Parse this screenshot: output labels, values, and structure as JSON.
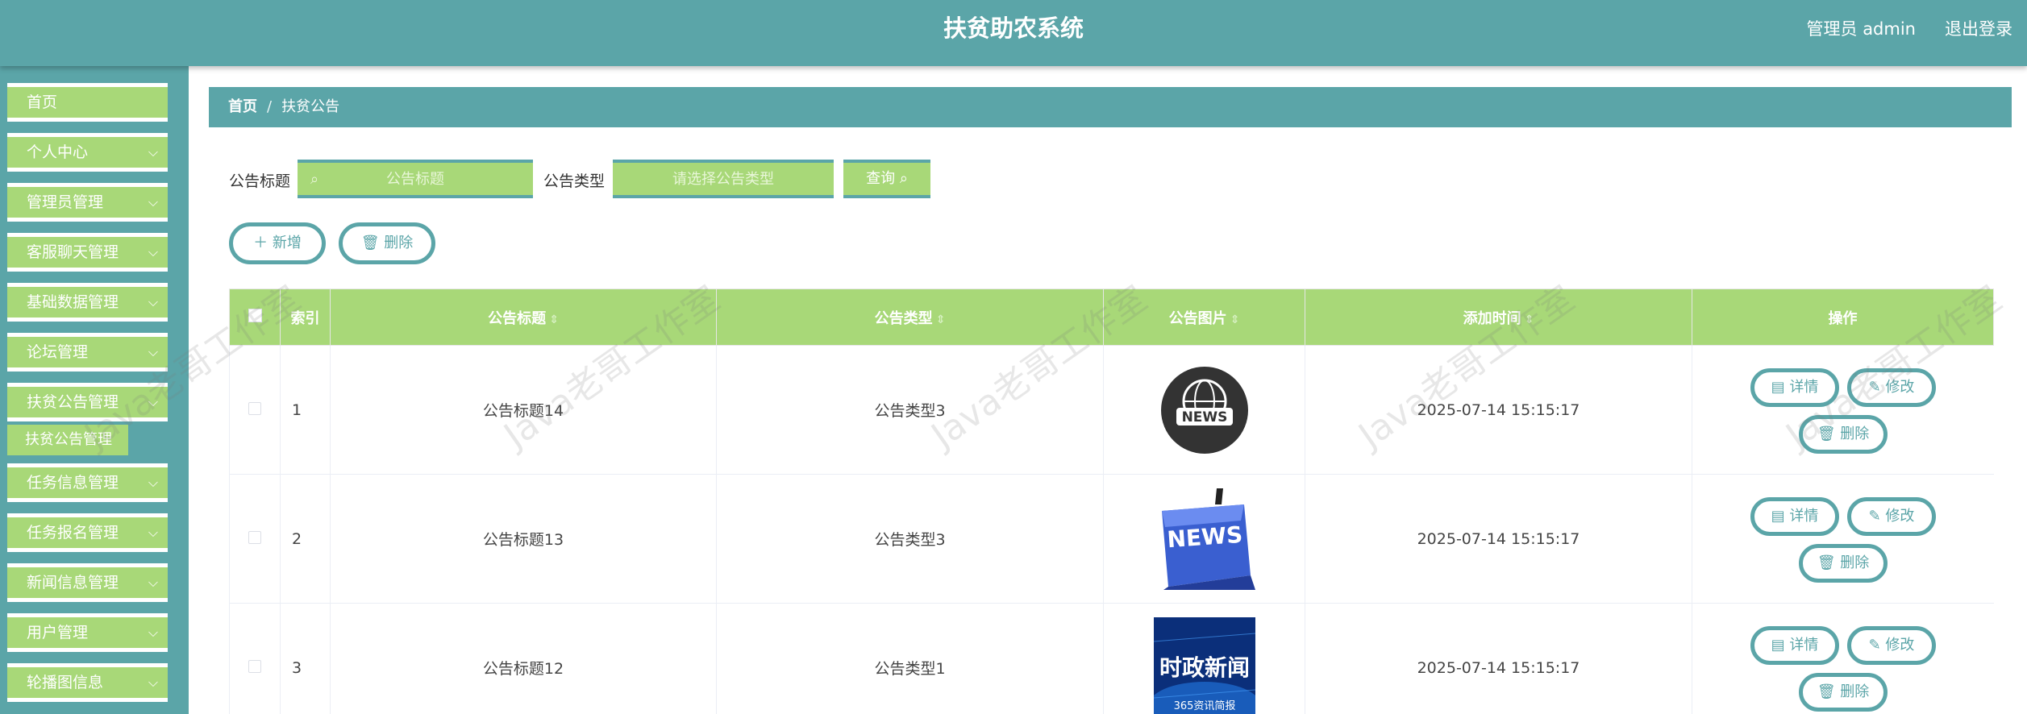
{
  "header": {
    "title": "扶贫助农系统",
    "user": "管理员 admin",
    "logout": "退出登录"
  },
  "sidebar": {
    "items": [
      {
        "label": "首页",
        "has_arrow": false
      },
      {
        "label": "个人中心",
        "has_arrow": true
      },
      {
        "label": "管理员管理",
        "has_arrow": true
      },
      {
        "label": "客服聊天管理",
        "has_arrow": true
      },
      {
        "label": "基础数据管理",
        "has_arrow": true
      },
      {
        "label": "论坛管理",
        "has_arrow": true
      },
      {
        "label": "扶贫公告管理",
        "has_arrow": true
      },
      {
        "label": "任务信息管理",
        "has_arrow": true
      },
      {
        "label": "任务报名管理",
        "has_arrow": true
      },
      {
        "label": "新闻信息管理",
        "has_arrow": true
      },
      {
        "label": "用户管理",
        "has_arrow": true
      },
      {
        "label": "轮播图信息",
        "has_arrow": true
      }
    ],
    "submenu": "扶贫公告管理",
    "arrow": "⌵"
  },
  "breadcrumb": {
    "home": "首页",
    "separator": "/",
    "current": "扶贫公告"
  },
  "search": {
    "title_label": "公告标题",
    "title_placeholder": "公告标题",
    "type_label": "公告类型",
    "type_placeholder": "请选择公告类型",
    "query_label": "查询"
  },
  "actions": {
    "add_label": "新增",
    "delete_label": "删除"
  },
  "table": {
    "headers": [
      "索引",
      "公告标题",
      "公告类型",
      "公告图片",
      "添加时间",
      "操作"
    ],
    "rows": [
      {
        "index": "1",
        "title": "公告标题14",
        "type": "公告类型3",
        "image": "news-globe-image",
        "time": "2025-07-14 15:15:17"
      },
      {
        "index": "2",
        "title": "公告标题13",
        "type": "公告类型3",
        "image": "news-keyboard-image",
        "time": "2025-07-14 15:15:17"
      },
      {
        "index": "3",
        "title": "公告标题12",
        "type": "公告类型1",
        "image": "political-news-image",
        "time": "2025-07-14 15:15:17"
      }
    ],
    "row_ops": {
      "detail": "详情",
      "edit": "修改",
      "delete": "删除"
    },
    "thumb_texts": {
      "news": "NEWS",
      "political_title": "时政新闻",
      "political_sub": "365资讯简报"
    }
  },
  "watermark": "Java老哥工作室",
  "colors": {
    "primary": "#5ba5a8",
    "accent": "#a8d878",
    "text": "#333333"
  }
}
